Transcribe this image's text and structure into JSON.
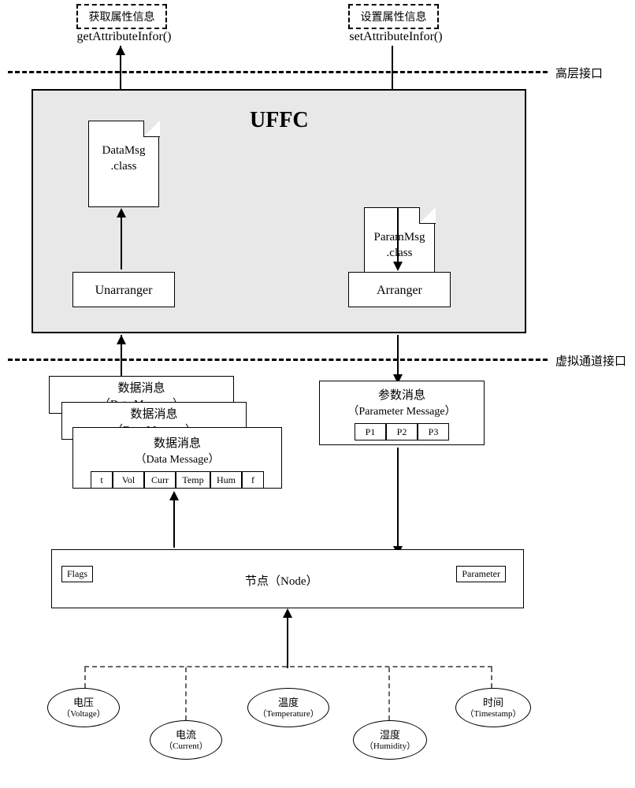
{
  "top": {
    "left_box": "获取属性信息",
    "left_method": "getAttributeInfor()",
    "right_box": "设置属性信息",
    "right_method": "setAttributeInfor()"
  },
  "interface_labels": {
    "high": "高层接口",
    "virtual": "虚拟通道接口"
  },
  "uffc": {
    "title": "UFFC",
    "data_doc_l1": "DataMsg",
    "data_doc_l2": ".class",
    "param_doc_l1": "ParamMsg",
    "param_doc_l2": ".class",
    "unarranger": "Unarranger",
    "arranger": "Arranger"
  },
  "messages": {
    "data_cn": "数据消息",
    "data_en": "（Data Message）",
    "param_cn": "参数消息",
    "param_en": "（Parameter Message）",
    "data_fields": [
      "t",
      "Vol",
      "Curr",
      "Temp",
      "Hum",
      "f"
    ],
    "param_fields": [
      "P1",
      "P2",
      "P3"
    ]
  },
  "node": {
    "flags": "Flags",
    "title_cn": "节点",
    "title_en": "（Node）",
    "parameter": "Parameter"
  },
  "sensors": {
    "voltage_cn": "电压",
    "voltage_en": "（Voltage）",
    "current_cn": "电流",
    "current_en": "（Current）",
    "temp_cn": "温度",
    "temp_en": "（Temperature）",
    "humidity_cn": "湿度",
    "humidity_en": "（Humidity）",
    "time_cn": "时间",
    "time_en": "（Timestamp）"
  }
}
